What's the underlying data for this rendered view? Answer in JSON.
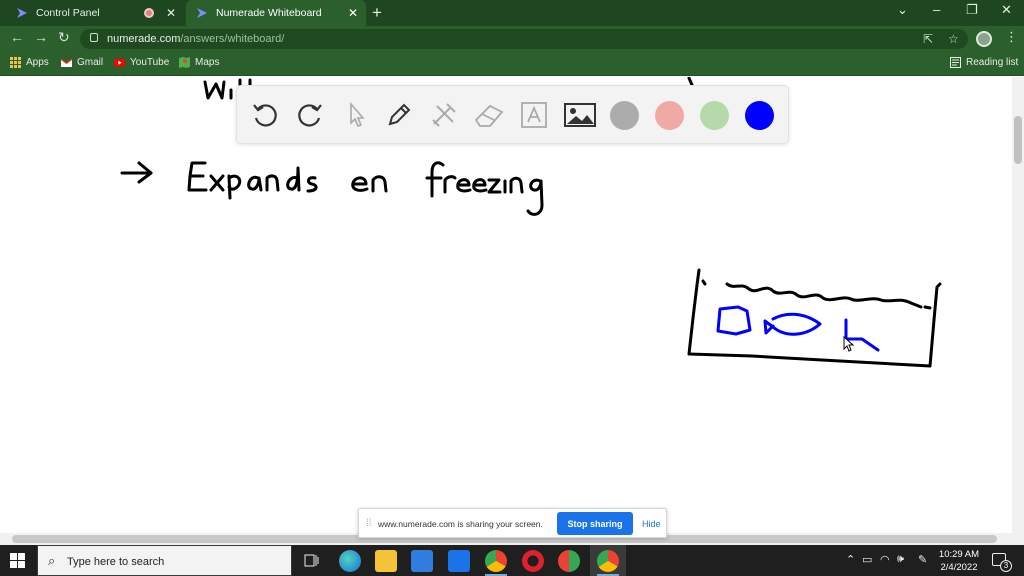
{
  "browser": {
    "tabs": [
      {
        "title": "Control Panel",
        "active": false
      },
      {
        "title": "Numerade Whiteboard",
        "active": true
      }
    ],
    "url_host": "numerade.com",
    "url_path": "/answers/whiteboard/",
    "bookmarks": [
      {
        "label": "Apps",
        "icon": "apps-grid-icon"
      },
      {
        "label": "Gmail",
        "icon": "gmail-icon"
      },
      {
        "label": "YouTube",
        "icon": "youtube-icon"
      },
      {
        "label": "Maps",
        "icon": "maps-icon"
      }
    ],
    "reading_list": "Reading list"
  },
  "whiteboard": {
    "handwriting_line1": "Expands on freezing",
    "colors": {
      "gray": "#acacac",
      "pink": "#f1a9a5",
      "green": "#b5d9a9",
      "blue": "#0000ff"
    },
    "selected_color": "blue"
  },
  "sharing": {
    "message": "www.numerade.com is sharing your screen.",
    "stop_label": "Stop sharing",
    "hide_label": "Hide"
  },
  "taskbar": {
    "search_placeholder": "Type here to search",
    "time": "10:29 AM",
    "date": "2/4/2022",
    "notification_count": "3"
  }
}
